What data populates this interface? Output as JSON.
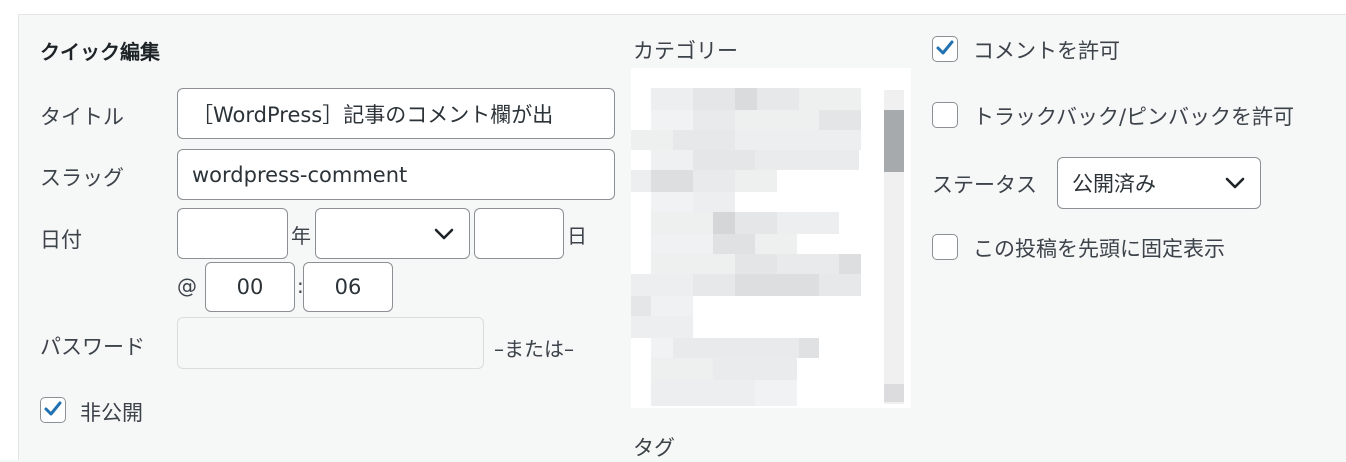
{
  "quick_edit": {
    "heading": "クイック編集",
    "title_label": "タイトル",
    "title_value": "［WordPress］記事のコメント欄が出",
    "slug_label": "スラッグ",
    "slug_value": "wordpress-comment",
    "date_label": "日付",
    "year_suffix": "年",
    "month_value": "",
    "day_suffix": "日",
    "at_symbol": "@",
    "hour_value": "00",
    "time_sep": ":",
    "minute_value": "06",
    "password_label": "パスワード",
    "password_or": "–または–",
    "private_label": "非公開",
    "private_checked": true
  },
  "categories": {
    "label": "カテゴリー",
    "content_state": "pixelated"
  },
  "tags": {
    "label": "タグ"
  },
  "options": {
    "allow_comments_label": "コメントを許可",
    "allow_comments_checked": true,
    "allow_pings_label": "トラックバック/ピンバックを許可",
    "allow_pings_checked": false,
    "status_label": "ステータス",
    "status_value": "公開済み",
    "sticky_label": "この投稿を先頭に固定表示",
    "sticky_checked": false
  },
  "colors": {
    "accent": "#2271b1",
    "panel_bg": "#f6f7f7"
  },
  "icons": {
    "check": "check-icon",
    "chevron": "chevron-down-icon"
  }
}
